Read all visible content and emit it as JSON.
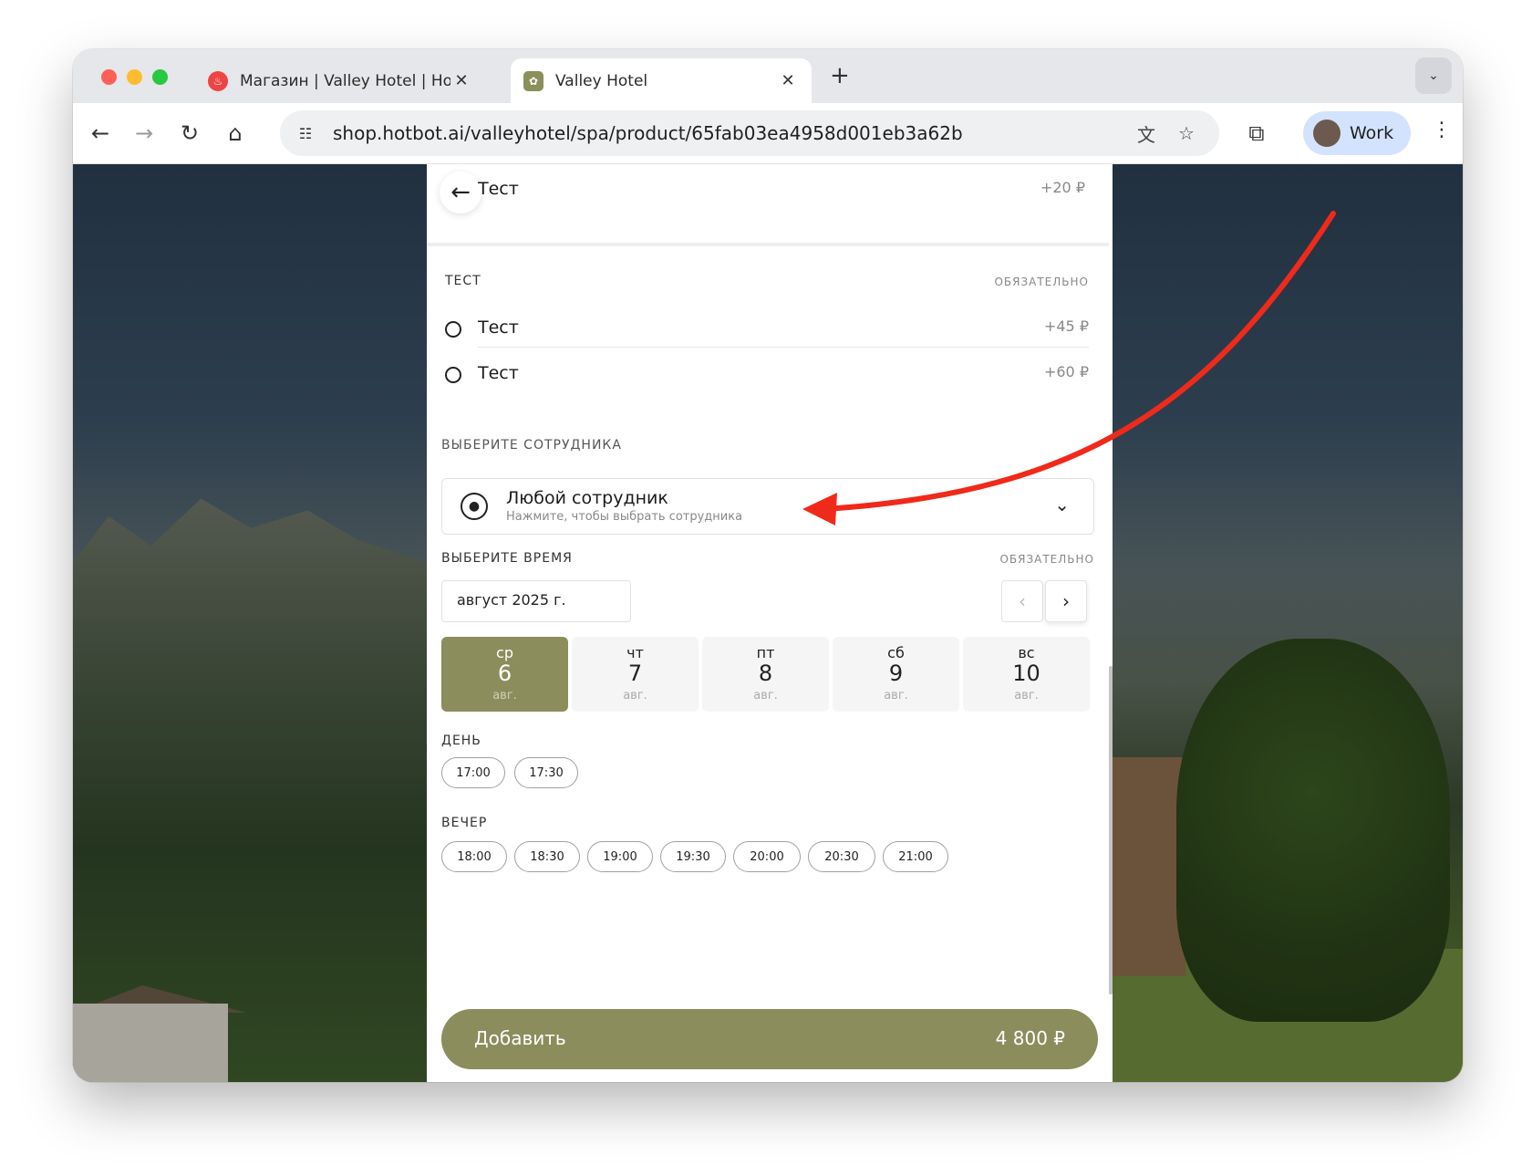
{
  "browser": {
    "tabs": [
      {
        "title": "Магазин | Valley Hotel | Hotbot",
        "active": false
      },
      {
        "title": "Valley Hotel",
        "active": true
      }
    ],
    "url": "shop.hotbot.ai/valleyhotel/spa/product/65fab03ea4958d001eb3a62b",
    "profile_name": "Work"
  },
  "panel": {
    "top_option": {
      "label": "Тест",
      "price": "+20 ₽"
    },
    "group": {
      "title": "ТЕСТ",
      "required": "ОБЯЗАТЕЛЬНО",
      "options": [
        {
          "label": "Тест",
          "price": "+45 ₽"
        },
        {
          "label": "Тест",
          "price": "+60 ₽"
        }
      ]
    },
    "staff": {
      "section_title": "ВЫБЕРИТЕ СОТРУДНИКА",
      "selected": "Любой сотрудник",
      "hint": "Нажмите, чтобы выбрать сотрудника"
    },
    "time": {
      "section_title": "ВЫБЕРИТЕ ВРЕМЯ",
      "required": "ОБЯЗАТЕЛЬНО",
      "month": "август 2025 г.",
      "days": [
        {
          "dow": "ср",
          "num": "6",
          "mon": "авг.",
          "selected": true
        },
        {
          "dow": "чт",
          "num": "7",
          "mon": "авг.",
          "selected": false
        },
        {
          "dow": "пт",
          "num": "8",
          "mon": "авг.",
          "selected": false
        },
        {
          "dow": "сб",
          "num": "9",
          "mon": "авг.",
          "selected": false
        },
        {
          "dow": "вс",
          "num": "10",
          "mon": "авг.",
          "selected": false
        }
      ],
      "day_title": "ДЕНЬ",
      "day_slots": [
        "17:00",
        "17:30"
      ],
      "evening_title": "ВЕЧЕР",
      "evening_slots": [
        "18:00",
        "18:30",
        "19:00",
        "19:30",
        "20:00",
        "20:30",
        "21:00"
      ]
    },
    "add_button": {
      "label": "Добавить",
      "price": "4 800 ₽"
    }
  },
  "colors": {
    "accent": "#8b8d5c",
    "annotation_arrow": "#f02a1a"
  }
}
